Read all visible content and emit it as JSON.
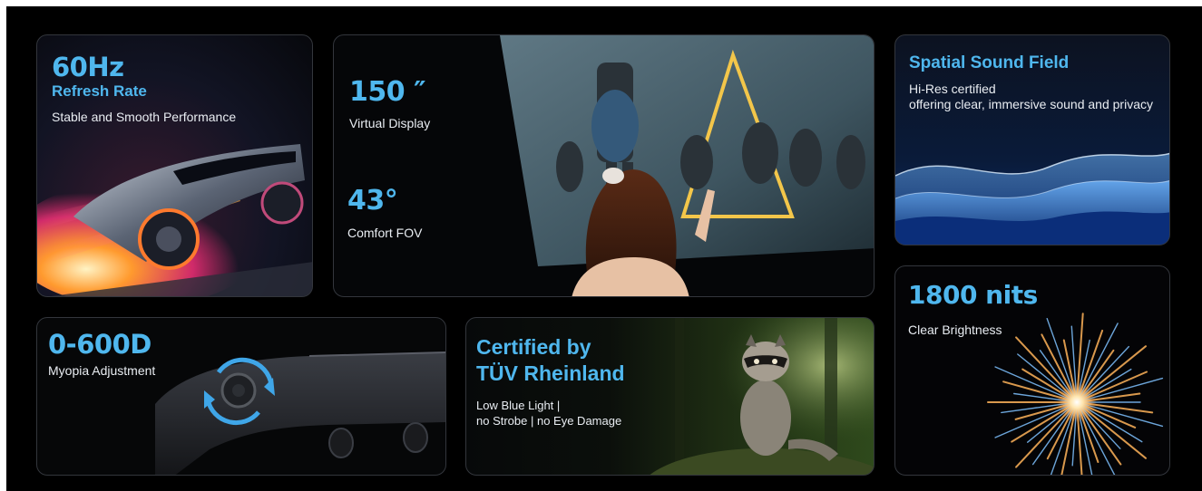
{
  "cards": {
    "refresh": {
      "value": "60Hz",
      "title": "Refresh Rate",
      "desc": "Stable and Smooth Performance",
      "image_icon": "race-car-image"
    },
    "display": {
      "size_value": "150 ″",
      "size_label": "Virtual Display",
      "fov_value": "43°",
      "fov_label": "Comfort FOV",
      "image_icon": "woman-watching-screen-image"
    },
    "sound": {
      "title": "Spatial Sound Field",
      "line1": "Hi-Res certified",
      "line2": "offering clear, immersive sound and privacy",
      "image_icon": "sound-wave-image"
    },
    "myopia": {
      "value": "0-600D",
      "label": "Myopia Adjustment",
      "image_icon": "glasses-dial-image"
    },
    "tuv": {
      "title_line1": "Certified by",
      "title_line2": "TÜV Rheinland",
      "line1": "Low Blue Light |",
      "line2": "no Strobe | no Eye Damage",
      "image_icon": "raccoon-forest-image"
    },
    "brightness": {
      "value": "1800 nits",
      "label": "Clear Brightness",
      "image_icon": "firework-image"
    }
  },
  "colors": {
    "accent": "#4fb7ee",
    "background": "#000000",
    "card_border": "#33363c",
    "text": "#e9edf2"
  }
}
